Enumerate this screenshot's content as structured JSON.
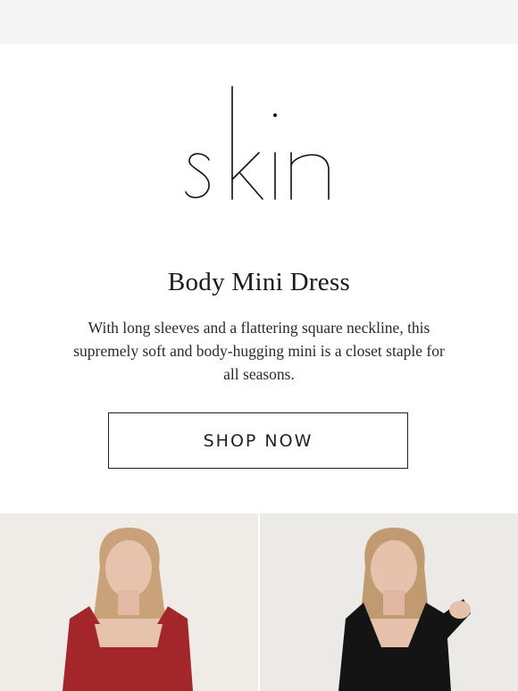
{
  "brand": {
    "logo_text": "skin",
    "logo_icon": "skin-wordmark"
  },
  "hero": {
    "headline": "Body Mini Dress",
    "description": "With long sleeves and a flattering square neckline, this supremely soft and body-hugging mini is a closet staple for all seasons.",
    "cta_label": "SHOP NOW"
  },
  "products": [
    {
      "alt": "Model wearing red Body Mini Dress",
      "dress_color": "#a3262a"
    },
    {
      "alt": "Model wearing black Body Mini Dress",
      "dress_color": "#141414"
    }
  ],
  "colors": {
    "topbar": "#f5f5f5",
    "text": "#1a1a1a",
    "border": "#222222"
  }
}
